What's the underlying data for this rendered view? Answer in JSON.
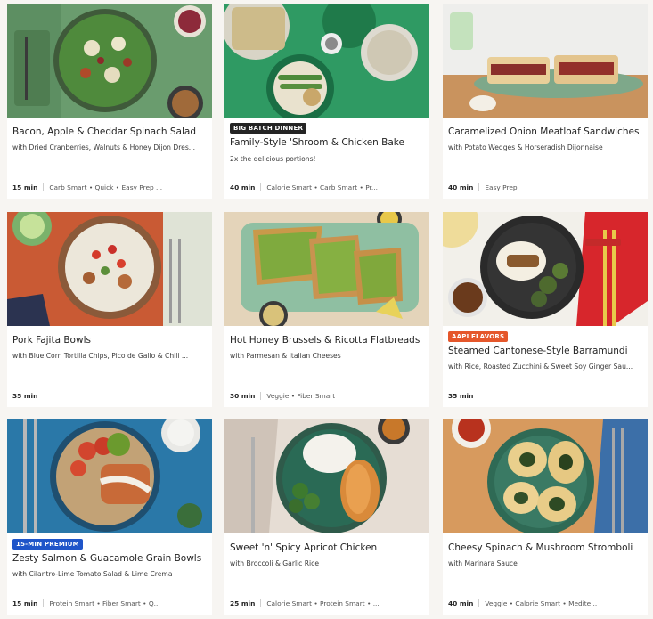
{
  "colors": {
    "badge_big_batch": "#242424",
    "badge_aapi": "#e5572b",
    "badge_premium": "#1f55c9"
  },
  "cards": [
    {
      "title": "Bacon, Apple & Cheddar Spinach Salad",
      "subtitle": "with Dried Cranberries, Walnuts & Honey Dijon Dres...",
      "time": "15 min",
      "tags": "Carb Smart • Quick • Easy Prep ...",
      "badge": "",
      "image": "spinach-salad"
    },
    {
      "title": "Family-Style 'Shroom & Chicken Bake",
      "subtitle": "2x the delicious portions!",
      "time": "40 min",
      "tags": "Calorie Smart • Carb Smart • Pr...",
      "badge": "BIG BATCH DINNER",
      "image": "chicken-bake"
    },
    {
      "title": "Caramelized Onion Meatloaf Sandwiches",
      "subtitle": "with Potato Wedges & Horseradish Dijonnaise",
      "time": "40 min",
      "tags": "Easy Prep",
      "badge": "",
      "image": "meatloaf-sandwich"
    },
    {
      "title": "Pork Fajita Bowls",
      "subtitle": "with Blue Corn Tortilla Chips, Pico de Gallo & Chili ...",
      "time": "35 min",
      "tags": "",
      "badge": "",
      "image": "fajita-bowl"
    },
    {
      "title": "Hot Honey Brussels & Ricotta Flatbreads",
      "subtitle": "with Parmesan & Italian Cheeses",
      "time": "30 min",
      "tags": "Veggie • Fiber Smart",
      "badge": "",
      "image": "flatbreads"
    },
    {
      "title": "Steamed Cantonese-Style Barramundi",
      "subtitle": "with Rice, Roasted Zucchini & Sweet Soy Ginger Sau...",
      "time": "35 min",
      "tags": "",
      "badge": "AAPI FLAVORS",
      "image": "barramundi"
    },
    {
      "title": "Zesty Salmon & Guacamole Grain Bowls",
      "subtitle": "with Cilantro-Lime Tomato Salad & Lime Crema",
      "time": "15 min",
      "tags": "Protein Smart • Fiber Smart • Q...",
      "badge": "15-MIN PREMIUM",
      "image": "salmon-bowl"
    },
    {
      "title": "Sweet 'n' Spicy Apricot Chicken",
      "subtitle": "with Broccoli & Garlic Rice",
      "time": "25 min",
      "tags": "Calorie Smart • Protein Smart • ...",
      "badge": "",
      "image": "apricot-chicken"
    },
    {
      "title": "Cheesy Spinach & Mushroom Stromboli",
      "subtitle": "with Marinara Sauce",
      "time": "40 min",
      "tags": "Veggie • Calorie Smart • Medite...",
      "badge": "",
      "image": "stromboli"
    }
  ]
}
